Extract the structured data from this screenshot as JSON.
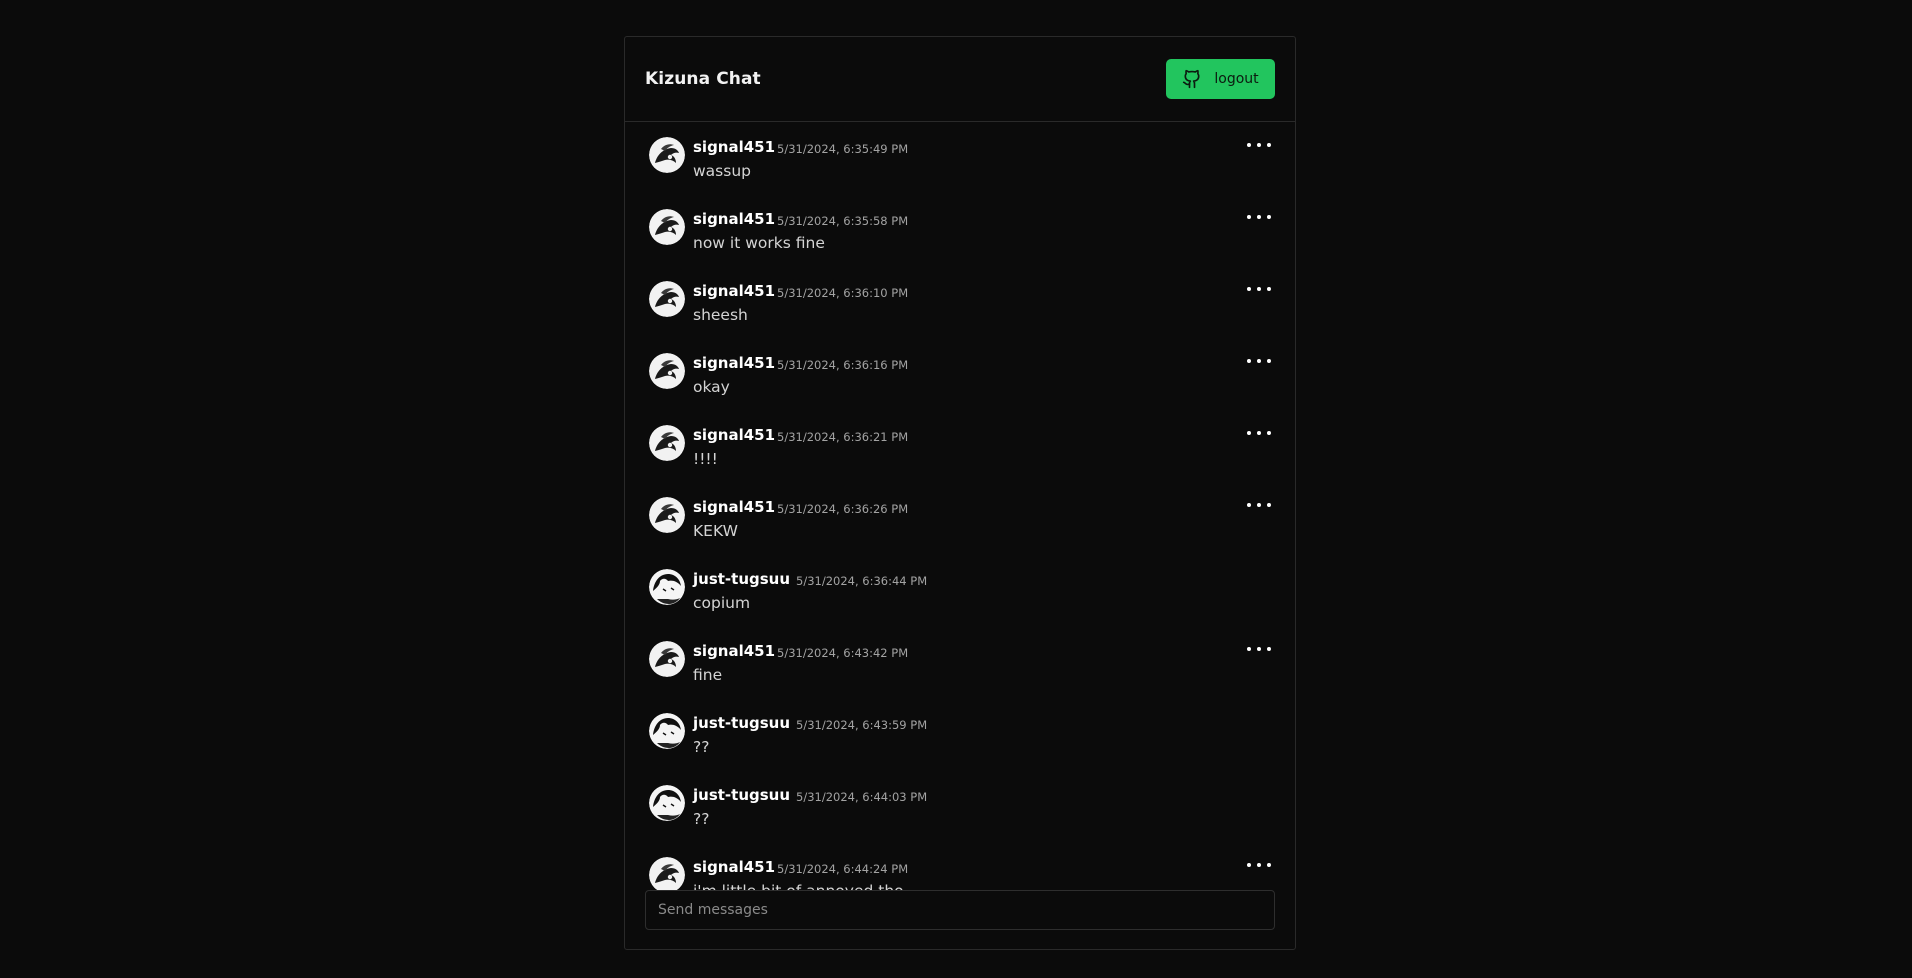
{
  "app": {
    "title": "Kizuna Chat"
  },
  "header": {
    "logout_label": "logout"
  },
  "composer": {
    "placeholder": "Send messages"
  },
  "messages": [
    {
      "author": "signal451",
      "time": "5/31/2024, 6:35:49 PM",
      "text": "wassup",
      "own": true
    },
    {
      "author": "signal451",
      "time": "5/31/2024, 6:35:58 PM",
      "text": "now it works fine",
      "own": true
    },
    {
      "author": "signal451",
      "time": "5/31/2024, 6:36:10 PM",
      "text": "sheesh",
      "own": true
    },
    {
      "author": "signal451",
      "time": "5/31/2024, 6:36:16 PM",
      "text": "okay",
      "own": true
    },
    {
      "author": "signal451",
      "time": "5/31/2024, 6:36:21 PM",
      "text": "!!!!",
      "own": true
    },
    {
      "author": "signal451",
      "time": "5/31/2024, 6:36:26 PM",
      "text": "KEKW",
      "own": true
    },
    {
      "author": "just-tugsuu",
      "time": "5/31/2024, 6:36:44 PM",
      "text": "copium",
      "own": false
    },
    {
      "author": "signal451",
      "time": "5/31/2024, 6:43:42 PM",
      "text": "fine",
      "own": true
    },
    {
      "author": "just-tugsuu",
      "time": "5/31/2024, 6:43:59 PM",
      "text": "??",
      "own": false
    },
    {
      "author": "just-tugsuu",
      "time": "5/31/2024, 6:44:03 PM",
      "text": "??",
      "own": false
    },
    {
      "author": "signal451",
      "time": "5/31/2024, 6:44:24 PM",
      "text": "i'm little bit of annoyed tho",
      "own": true
    }
  ]
}
